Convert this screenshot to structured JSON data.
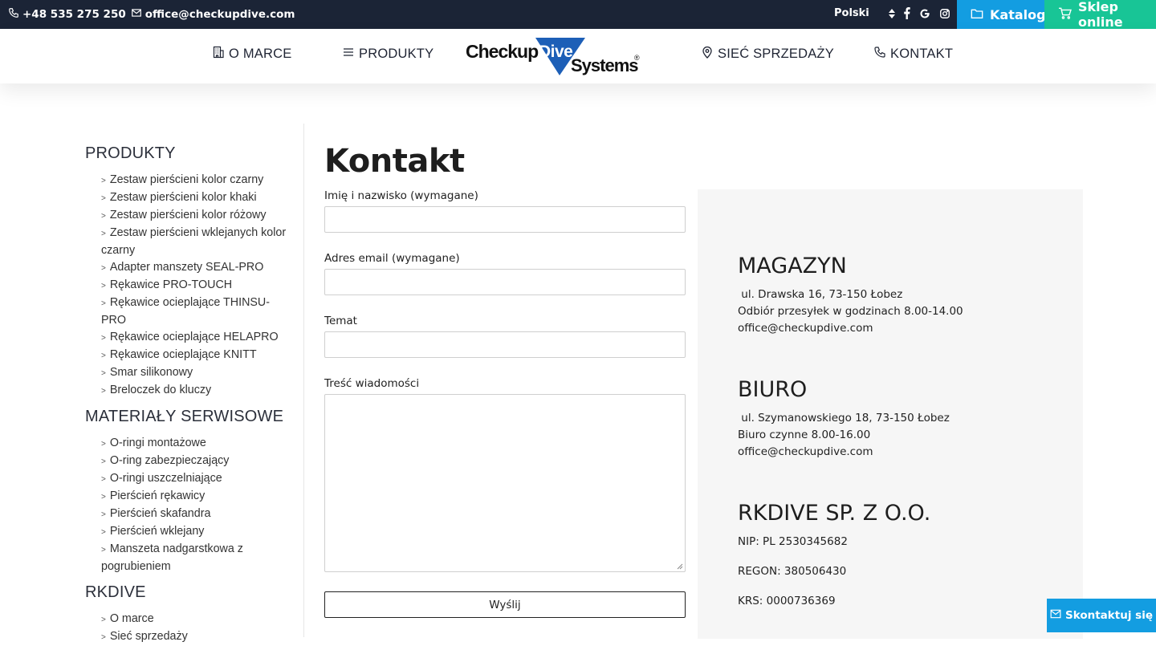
{
  "topbar": {
    "phone": "+48 535 275 250",
    "email": "office@checkupdive.com",
    "language": "Polski",
    "social_icons": [
      "facebook-icon",
      "google-icon",
      "instagram-icon"
    ],
    "katalog_label": "Katalog",
    "sklep_label": "Sklep online",
    "colors": {
      "bar": "#1b2436",
      "katalog": "#139de1",
      "sklep": "#18c596"
    }
  },
  "nav": {
    "o_marce": "O MARCE",
    "produkty": "PRODUKTY",
    "siec": "SIEĆ SPRZEDAŻY",
    "kontakt": "KONTAKT",
    "logo_text_1": "Checkup",
    "logo_text_2": "Dive",
    "logo_text_3": "Systems",
    "logo_mark": "®"
  },
  "sidebar": {
    "produkty_heading": "PRODUKTY",
    "produkty_items": [
      "Zestaw pierścieni kolor czarny",
      "Zestaw pierścieni kolor khaki",
      "Zestaw pierścieni kolor różowy",
      "Zestaw pierścieni wklejanych kolor czarny",
      "Adapter manszety SEAL-PRO",
      "Rękawice PRO-TOUCH",
      "Rękawice ocieplające THINSU-PRO",
      "Rękawice ocieplające HELAPRO",
      "Rękawice ocieplające KNITT",
      "Smar silikonowy",
      "Breloczek do kluczy"
    ],
    "materialy_heading": "MATERIAŁY SERWISOWE",
    "materialy_items": [
      "O-ringi montażowe",
      "O-ring zabezpieczający",
      "O-ringi uszczelniające",
      "Pierścień rękawicy",
      "Pierścień skafandra",
      "Pierścień wklejany",
      "Manszeta nadgarstkowa z pogrubieniem"
    ],
    "rkdive_heading": "RKDIVE",
    "rkdive_items": [
      "O marce",
      "Sieć sprzedaży"
    ]
  },
  "main": {
    "title": "Kontakt",
    "form": {
      "name_label": "Imię i nazwisko (wymagane)",
      "email_label": "Adres email (wymagane)",
      "subject_label": "Temat",
      "message_label": "Treść wiadomości",
      "submit_label": "Wyślij"
    }
  },
  "info": {
    "magazyn_heading": "MAGAZYN",
    "magazyn_address": " ul. Drawska 16, 73-150 Łobez",
    "magazyn_hours": "Odbiór przesyłek w godzinach 8.00-14.00",
    "magazyn_email": "office@checkupdive.com",
    "biuro_heading": "BIURO",
    "biuro_address": " ul. Szymanowskiego 18, 73-150 Łobez",
    "biuro_hours": "Biuro czynne 8.00-16.00",
    "biuro_email": "office@checkupdive.com",
    "company_heading": "RKDIVE SP. Z O.O.",
    "nip": "NIP: PL 2530345682",
    "regon": "REGON: 380506430",
    "krs": "KRS: 0000736369"
  },
  "floating": {
    "label": "Skontaktuj się"
  }
}
